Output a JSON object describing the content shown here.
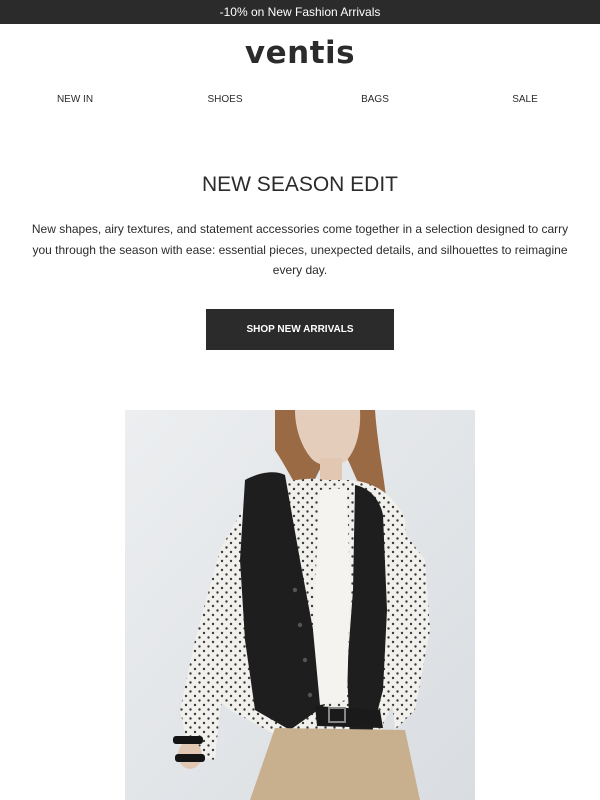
{
  "promo": {
    "text": "-10% on New Fashion Arrivals"
  },
  "brand": {
    "logo_text": "ventis"
  },
  "nav": {
    "items": [
      {
        "label": "NEW IN"
      },
      {
        "label": "SHOES"
      },
      {
        "label": "BAGS"
      },
      {
        "label": "SALE"
      }
    ]
  },
  "hero_section": {
    "headline": "NEW SEASON EDIT",
    "body": "New shapes, airy textures, and statement accessories come together in a selection designed to carry you through the season with ease: essential pieces, unexpected details, and silhouettes to reimagine every day.",
    "cta_label": "SHOP NEW ARRIVALS"
  },
  "colors": {
    "dark": "#2b2b2b",
    "background": "#ffffff",
    "photo_backdrop": "#e6e8ea"
  }
}
